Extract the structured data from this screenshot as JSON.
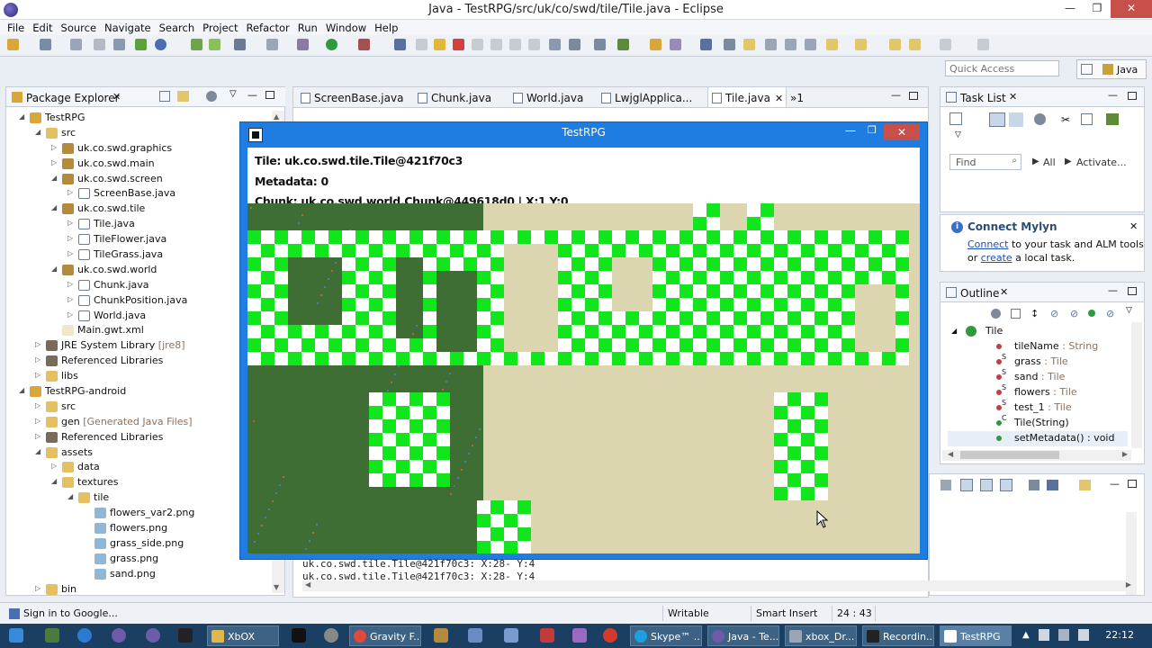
{
  "window": {
    "title": "Java - TestRPG/src/uk/co/swd/tile/Tile.java - Eclipse"
  },
  "menu": [
    "File",
    "Edit",
    "Source",
    "Navigate",
    "Search",
    "Project",
    "Refactor",
    "Run",
    "Window",
    "Help"
  ],
  "toolbar": {
    "quick_access_placeholder": "Quick Access",
    "perspective": "Java"
  },
  "package_explorer": {
    "title": "Package Explorer",
    "tree": [
      {
        "level": 0,
        "arrow": "open",
        "icon": "project",
        "label": "TestRPG"
      },
      {
        "level": 1,
        "arrow": "open",
        "icon": "folder",
        "label": "src"
      },
      {
        "level": 2,
        "arrow": "closed",
        "icon": "package",
        "label": "uk.co.swd.graphics"
      },
      {
        "level": 2,
        "arrow": "closed",
        "icon": "package",
        "label": "uk.co.swd.main"
      },
      {
        "level": 2,
        "arrow": "open",
        "icon": "package",
        "label": "uk.co.swd.screen"
      },
      {
        "level": 3,
        "arrow": "closed",
        "icon": "java",
        "label": "ScreenBase.java"
      },
      {
        "level": 2,
        "arrow": "open",
        "icon": "package",
        "label": "uk.co.swd.tile"
      },
      {
        "level": 3,
        "arrow": "closed",
        "icon": "java",
        "label": "Tile.java"
      },
      {
        "level": 3,
        "arrow": "closed",
        "icon": "java",
        "label": "TileFlower.java"
      },
      {
        "level": 3,
        "arrow": "closed",
        "icon": "java",
        "label": "TileGrass.java"
      },
      {
        "level": 2,
        "arrow": "open",
        "icon": "package",
        "label": "uk.co.swd.world"
      },
      {
        "level": 3,
        "arrow": "closed",
        "icon": "java",
        "label": "Chunk.java"
      },
      {
        "level": 3,
        "arrow": "closed",
        "icon": "java",
        "label": "ChunkPosition.java"
      },
      {
        "level": 3,
        "arrow": "closed",
        "icon": "java",
        "label": "World.java"
      },
      {
        "level": 2,
        "arrow": "none",
        "icon": "xml",
        "label": "Main.gwt.xml"
      },
      {
        "level": 1,
        "arrow": "closed",
        "icon": "library",
        "label": "JRE System Library",
        "suffix": "[jre8]"
      },
      {
        "level": 1,
        "arrow": "closed",
        "icon": "library",
        "label": "Referenced Libraries"
      },
      {
        "level": 1,
        "arrow": "closed",
        "icon": "folder",
        "label": "libs"
      },
      {
        "level": 0,
        "arrow": "open",
        "icon": "project",
        "label": "TestRPG-android"
      },
      {
        "level": 1,
        "arrow": "closed",
        "icon": "folder",
        "label": "src"
      },
      {
        "level": 1,
        "arrow": "closed",
        "icon": "folder",
        "label": "gen",
        "suffix": "[Generated Java Files]"
      },
      {
        "level": 1,
        "arrow": "closed",
        "icon": "library",
        "label": "Referenced Libraries"
      },
      {
        "level": 1,
        "arrow": "open",
        "icon": "folder",
        "label": "assets"
      },
      {
        "level": 2,
        "arrow": "closed",
        "icon": "folder",
        "label": "data"
      },
      {
        "level": 2,
        "arrow": "open",
        "icon": "folder",
        "label": "textures"
      },
      {
        "level": 3,
        "arrow": "open",
        "icon": "folder",
        "label": "tile"
      },
      {
        "level": 4,
        "arrow": "none",
        "icon": "image",
        "label": "flowers_var2.png"
      },
      {
        "level": 4,
        "arrow": "none",
        "icon": "image",
        "label": "flowers.png"
      },
      {
        "level": 4,
        "arrow": "none",
        "icon": "image",
        "label": "grass_side.png"
      },
      {
        "level": 4,
        "arrow": "none",
        "icon": "image",
        "label": "grass.png"
      },
      {
        "level": 4,
        "arrow": "none",
        "icon": "image",
        "label": "sand.png"
      },
      {
        "level": 1,
        "arrow": "closed",
        "icon": "folder",
        "label": "bin"
      }
    ]
  },
  "editor_tabs": [
    {
      "label": "ScreenBase.java"
    },
    {
      "label": "Chunk.java"
    },
    {
      "label": "World.java"
    },
    {
      "label": "LwjglApplica..."
    },
    {
      "label": "Tile.java",
      "active": true
    }
  ],
  "editor_overflow": "»1",
  "console_lines": [
    "uk.co.swd.tile.Tile@421f70c3: X:28- Y:4",
    "uk.co.swd.tile.Tile@421f70c3: X:28- Y:4"
  ],
  "task_list": {
    "title": "Task List",
    "find_placeholder": "Find",
    "all": "All",
    "activate": "Activate..."
  },
  "mylyn": {
    "title": "Connect Mylyn",
    "connect": "Connect",
    "text1": " to your task and ALM tools",
    "text2": "or ",
    "create": "create",
    "text3": " a local task."
  },
  "outline": {
    "title": "Outline",
    "class_name": "Tile",
    "members": [
      {
        "name": "tileName",
        "type": " : String",
        "mod": ""
      },
      {
        "name": "grass",
        "type": " : Tile",
        "mod": "S"
      },
      {
        "name": "sand",
        "type": " : Tile",
        "mod": "S"
      },
      {
        "name": "flowers",
        "type": " : Tile",
        "mod": "S"
      },
      {
        "name": "test_1",
        "type": " : Tile",
        "mod": "S"
      },
      {
        "name": "Tile(String)",
        "type": "",
        "mod": "c"
      },
      {
        "name": "setMetadata() : void",
        "type": "",
        "mod": ""
      }
    ]
  },
  "status": {
    "left": "Sign in to Google...",
    "writable": "Writable",
    "insert": "Smart Insert",
    "position": "24 : 43"
  },
  "game": {
    "title": "TestRPG",
    "hud_tile": "Tile: uk.co.swd.tile.Tile@421f70c3",
    "hud_metadata": "Metadata: 0",
    "hud_chunk": "Chunk: uk.co.swd.world.Chunk@449618d0 | X:1 Y:0",
    "colors": {
      "grass": "#3f6e35",
      "sand": "#dcd6b0",
      "green": "#11e51b",
      "white": "#ffffff"
    }
  },
  "taskbar": {
    "buttons": [
      "XbOX",
      "Gravity F...",
      "Skype™ ...",
      "Java - Te...",
      "xbox_Dr...",
      "Recordin...",
      "TestRPG"
    ],
    "clock": "22:12"
  }
}
